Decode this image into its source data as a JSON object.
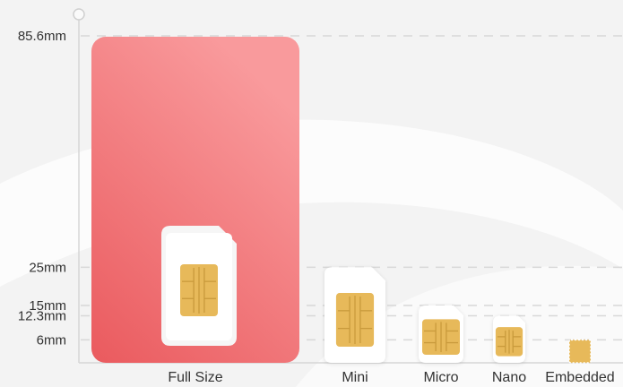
{
  "chart_data": {
    "type": "bar",
    "title": "",
    "xlabel": "",
    "ylabel": "",
    "unit": "mm",
    "y_ticks": [
      {
        "value": 85.6,
        "label": "85.6mm"
      },
      {
        "value": 25,
        "label": "25mm"
      },
      {
        "value": 15,
        "label": "15mm"
      },
      {
        "value": 12.3,
        "label": "12.3mm"
      },
      {
        "value": 6,
        "label": "6mm"
      }
    ],
    "categories": [
      "Full Size",
      "Mini",
      "Micro",
      "Nano",
      "Embedded"
    ],
    "values": [
      85.6,
      25,
      15,
      12.3,
      6
    ],
    "grid": "dashed horizontal at tick values",
    "colors": {
      "full_size_card": "#ee6b6e",
      "full_size_card_light": "#f89a9c",
      "sim_card": "#ffffff",
      "chip": "#e7b95a",
      "chip_lines": "#c99a3c",
      "background": "#f3f3f3",
      "axis": "#d7d7d7",
      "grid": "#d8d8d8"
    }
  }
}
